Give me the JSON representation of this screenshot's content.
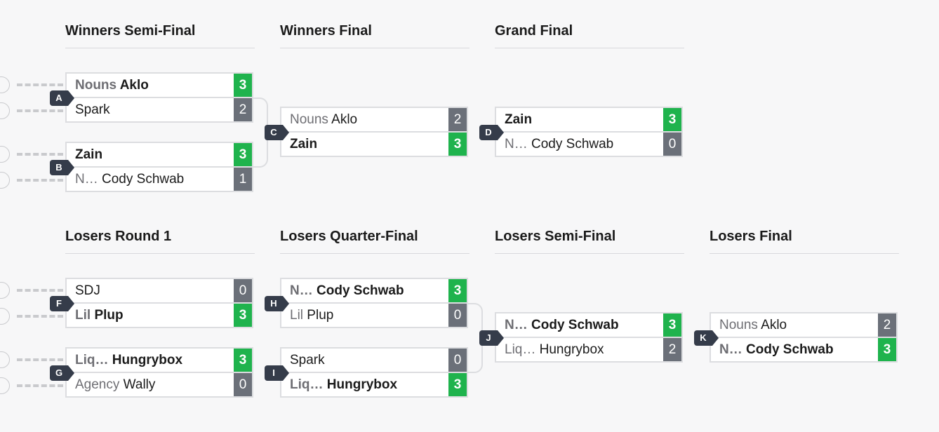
{
  "rounds": {
    "winners_semi": "Winners Semi-Final",
    "winners_final": "Winners Final",
    "grand_final": "Grand Final",
    "losers_r1": "Losers Round 1",
    "losers_qf": "Losers Quarter-Final",
    "losers_sf": "Losers Semi-Final",
    "losers_final": "Losers Final"
  },
  "matches": {
    "A": {
      "label": "A",
      "top": {
        "team": "Nouns",
        "player": "Aklo",
        "score": "3",
        "result": "win"
      },
      "bottom": {
        "team": "",
        "player": "Spark",
        "score": "2",
        "result": "lose"
      }
    },
    "B": {
      "label": "B",
      "top": {
        "team": "",
        "player": "Zain",
        "score": "3",
        "result": "win"
      },
      "bottom": {
        "team": "N…",
        "player": "Cody Schwab",
        "score": "1",
        "result": "lose"
      }
    },
    "C": {
      "label": "C",
      "top": {
        "team": "Nouns",
        "player": "Aklo",
        "score": "2",
        "result": "lose"
      },
      "bottom": {
        "team": "",
        "player": "Zain",
        "score": "3",
        "result": "win"
      }
    },
    "D": {
      "label": "D",
      "top": {
        "team": "",
        "player": "Zain",
        "score": "3",
        "result": "win"
      },
      "bottom": {
        "team": "N…",
        "player": "Cody Schwab",
        "score": "0",
        "result": "lose"
      }
    },
    "F": {
      "label": "F",
      "top": {
        "team": "",
        "player": "SDJ",
        "score": "0",
        "result": "lose"
      },
      "bottom": {
        "team": "Lil",
        "player": "Plup",
        "score": "3",
        "result": "win"
      }
    },
    "G": {
      "label": "G",
      "top": {
        "team": "Liq…",
        "player": "Hungrybox",
        "score": "3",
        "result": "win"
      },
      "bottom": {
        "team": "Agency",
        "player": "Wally",
        "score": "0",
        "result": "lose"
      }
    },
    "H": {
      "label": "H",
      "top": {
        "team": "N…",
        "player": "Cody Schwab",
        "score": "3",
        "result": "win"
      },
      "bottom": {
        "team": "Lil",
        "player": "Plup",
        "score": "0",
        "result": "lose"
      }
    },
    "I": {
      "label": "I",
      "top": {
        "team": "",
        "player": "Spark",
        "score": "0",
        "result": "lose"
      },
      "bottom": {
        "team": "Liq…",
        "player": "Hungrybox",
        "score": "3",
        "result": "win"
      }
    },
    "J": {
      "label": "J",
      "top": {
        "team": "N…",
        "player": "Cody Schwab",
        "score": "3",
        "result": "win"
      },
      "bottom": {
        "team": "Liq…",
        "player": "Hungrybox",
        "score": "2",
        "result": "lose"
      }
    },
    "K": {
      "label": "K",
      "top": {
        "team": "Nouns",
        "player": "Aklo",
        "score": "2",
        "result": "lose"
      },
      "bottom": {
        "team": "N…",
        "player": "Cody Schwab",
        "score": "3",
        "result": "win"
      }
    }
  },
  "colors": {
    "win": "#1fb34d",
    "lose": "#6b7079",
    "badge": "#353c4a"
  }
}
